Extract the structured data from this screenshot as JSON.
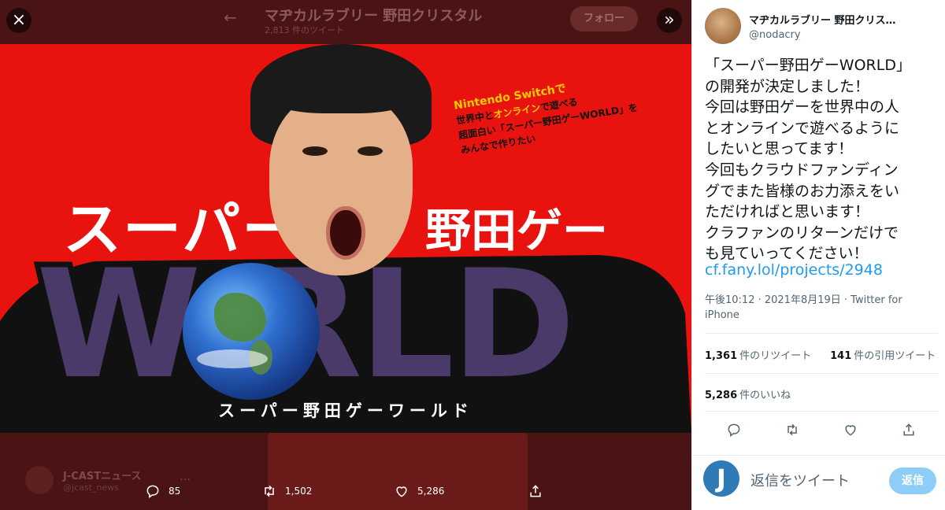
{
  "background": {
    "back_arrow": "←",
    "account_title": "マヂカルラブリー 野田クリスタル",
    "account_sub": "2,813 件のツイート",
    "follow_label": "フォロー",
    "quoted_name": "J-CASTニュース",
    "quoted_handle": "@jcast_news",
    "quoted_more": "…"
  },
  "viewer": {
    "close_icon": "×",
    "expand_icon": "»",
    "image": {
      "promo_line1": "Nintendo Switchで",
      "promo_line2": "世界中と",
      "promo_line2_hl": "オンライン",
      "promo_line2_end": "で遊べる",
      "promo_line3": "超面白い「スーパー野田ゲーWORLD」を",
      "promo_line4": "みんなで作りたい",
      "title_part1": "スーパー",
      "title_part2": "野田ゲー",
      "world": "W  RLD",
      "subtitle": "スーパー野田ゲーワールド"
    },
    "actions": {
      "reply_count": "85",
      "retweet_count": "1,502",
      "like_count": "5,286"
    }
  },
  "tweet": {
    "author_name": "マヂカルラブリー 野田クリス…",
    "author_handle": "@nodacry",
    "text": "「スーパー野田ゲーWORLD」\nの開発が決定しました！\n今回は野田ゲーを世界中の人\nとオンラインで遊べるように\nしたいと思ってます！\n今回もクラウドファンディン\nグでまた皆様のお力添えをい\nただければと思います！\nクラファンのリターンだけで\nも見ていってください！",
    "link": "cf.fany.lol/projects/2948",
    "meta": "午後10:12 · 2021年8月19日 · Twitter for iPhone",
    "retweets_num": "1,361",
    "retweets_label": "件のリツイート",
    "quotes_num": "141",
    "quotes_label": "件の引用ツイート",
    "likes_num": "5,286",
    "likes_label": "件のいいね"
  },
  "reply_box": {
    "avatar_letter": "J",
    "placeholder": "返信をツイート",
    "button_label": "返信"
  },
  "colors": {
    "accent": "#1d9bf0",
    "reply_button": "#8ecdf8",
    "image_red": "#e8120f"
  }
}
